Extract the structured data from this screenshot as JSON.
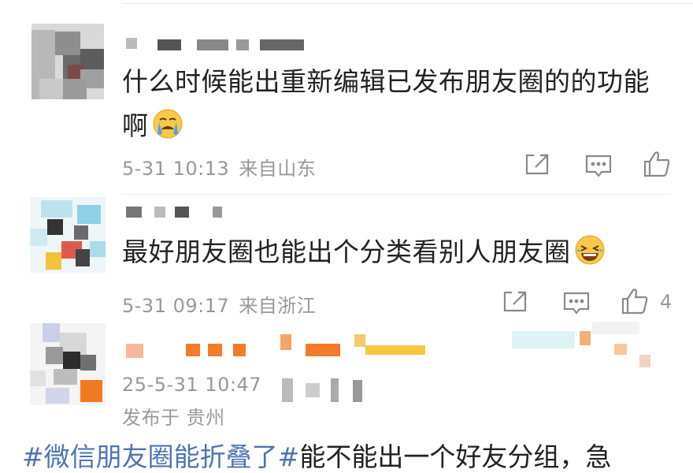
{
  "comments": [
    {
      "text_line1": "什么时候能出重新编辑已发布朋友圈的的功能",
      "text_line2": "啊",
      "emoji": "crying-face",
      "time": "5-31 10:13",
      "location": "来自山东",
      "like_count": ""
    },
    {
      "text": "最好朋友圈也能出个分类看别人朋友圈",
      "emoji": "laughing-tears-face",
      "time": "5-31 09:17",
      "location": "来自浙江",
      "like_count": "4"
    },
    {
      "time": "25-5-31 10:47",
      "location": "发布于 贵州"
    }
  ],
  "post": {
    "topic": "#微信朋友圈能折叠了#",
    "text": "能不能出一个好友分组，急"
  },
  "colors": {
    "text": "#222222",
    "meta": "#999999",
    "topic": "#4f74b3",
    "icon": "#8a8a8a"
  },
  "icons": {
    "share": "share-icon",
    "comment": "comment-icon",
    "like": "thumbs-up-icon"
  }
}
